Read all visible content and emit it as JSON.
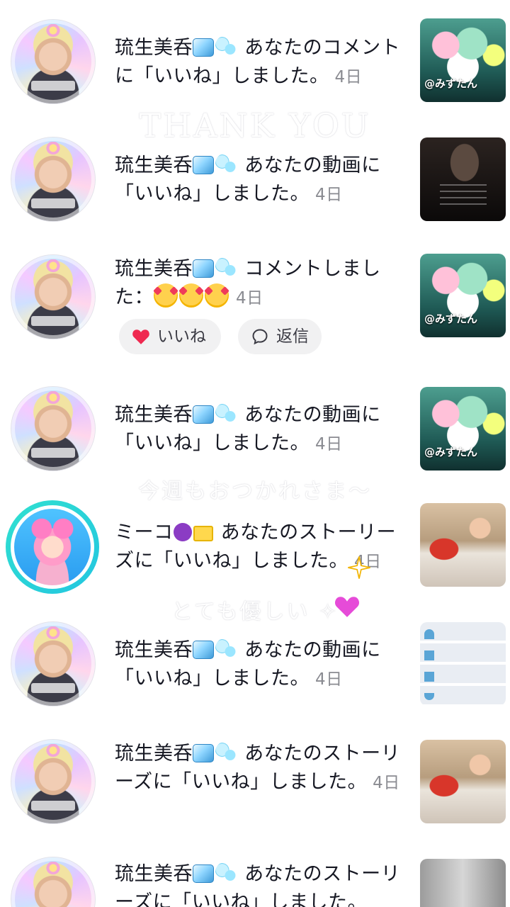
{
  "notifications": [
    {
      "user": "琉生美呑",
      "message": "あなたのコメントに「いいね」しました。",
      "time": "4日",
      "thumb_caption": "@みずたん"
    },
    {
      "user": "琉生美呑",
      "message": "あなたの動画に「いいね」しました。",
      "time": "4日"
    },
    {
      "user": "琉生美呑",
      "message": "コメントしました：",
      "time": "4日",
      "thumb_caption": "@みずたん",
      "actions": {
        "like_label": "いいね",
        "reply_label": "返信"
      }
    },
    {
      "user": "琉生美呑",
      "message": "あなたの動画に「いいね」しました。",
      "time": "4日",
      "thumb_caption": "@みずたん"
    },
    {
      "user": "ミーコ",
      "message": "あなたのストーリーズに「いいね」しました。",
      "time": "4日"
    },
    {
      "user": "琉生美呑",
      "message": "あなたの動画に「いいね」しました。",
      "time": "4日"
    },
    {
      "user": "琉生美呑",
      "message": "あなたのストーリーズに「いいね」しました。",
      "time": "4日"
    },
    {
      "user": "琉生美呑",
      "message": "あなたのストーリーズに「いいね」しました。",
      "time": ""
    }
  ],
  "overlay": {
    "line1": "THANK YOU",
    "line2": "今週もおつかれさま〜",
    "line3": "とても優しい ✧"
  },
  "colors": {
    "like_heart": "#ef2950",
    "story_ring": "#2cd6d6",
    "time_text": "#8a8b91",
    "pill_bg": "#f1f1f2"
  }
}
